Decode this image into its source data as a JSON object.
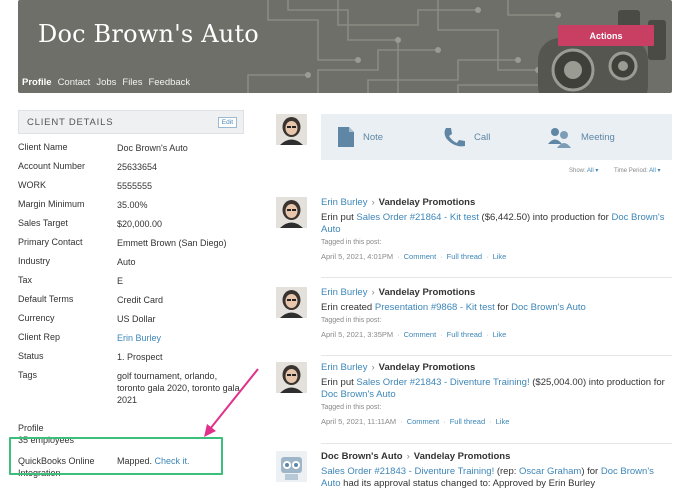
{
  "header": {
    "company_name": "Doc Brown's Auto",
    "actions_label": "Actions",
    "tabs": [
      "Profile",
      "Contact",
      "Jobs",
      "Files",
      "Feedback"
    ],
    "brand_color": "#c83f63"
  },
  "details": {
    "title": "CLIENT DETAILS",
    "edit_label": "Edit",
    "rows": [
      {
        "key": "Client Name",
        "value": "Doc Brown's Auto"
      },
      {
        "key": "Account Number",
        "value": "25633654"
      },
      {
        "key": "WORK",
        "value": "5555555"
      },
      {
        "key": "Margin Minimum",
        "value": "35.00%"
      },
      {
        "key": "Sales Target",
        "value": "$20,000.00"
      },
      {
        "key": "Primary Contact",
        "value": "Emmett Brown (San Diego)"
      },
      {
        "key": "Industry",
        "value": "Auto"
      },
      {
        "key": "Tax",
        "value": "E"
      },
      {
        "key": "Default Terms",
        "value": "Credit Card"
      },
      {
        "key": "Currency",
        "value": "US Dollar"
      },
      {
        "key": "Client Rep",
        "value": "Erin Burley"
      },
      {
        "key": "Status",
        "value": "1. Prospect"
      },
      {
        "key": "Tags",
        "value": "golf tournament, orlando, toronto gala 2020, toronto gala 2021"
      }
    ],
    "profile_label": "Profile",
    "profile_value": "35 employees",
    "qb_label": "QuickBooks Online Integration",
    "qb_value": "Mapped.",
    "qb_link": "Check it.",
    "highlight_color": "#3bbf7a",
    "arrow_color": "#e0318a"
  },
  "quick_actions": {
    "note": "Note",
    "call": "Call",
    "meeting": "Meeting"
  },
  "filters": {
    "show_label": "Show:",
    "show_value": "All ▾",
    "period_label": "Time Period:",
    "period_value": "All ▾"
  },
  "feed": [
    {
      "author": "Erin Burley",
      "target": "Vandelay Promotions",
      "text_pre": "Erin put ",
      "link1": "Sales Order #21864 - Kit test",
      "text_mid": " ($6,442.50) into production for ",
      "link2": "Doc Brown's Auto",
      "tagged": "Tagged in this post:",
      "date": "April 5, 2021, 4:01PM",
      "comment": "Comment",
      "thread": "Full thread",
      "like": "Like"
    },
    {
      "author": "Erin Burley",
      "target": "Vandelay Promotions",
      "text_pre": "Erin created ",
      "link1": "Presentation #9868 - Kit test",
      "text_mid": " for ",
      "link2": "Doc Brown's Auto",
      "tagged": "Tagged in this post:",
      "date": "April 5, 2021, 3:35PM",
      "comment": "Comment",
      "thread": "Full thread",
      "like": "Like"
    },
    {
      "author": "Erin Burley",
      "target": "Vandelay Promotions",
      "text_pre": "Erin put ",
      "link1": "Sales Order #21843 - Diventure Training!",
      "text_mid": " ($25,004.00) into production for ",
      "link2": "Doc Brown's Auto",
      "tagged": "Tagged in this post:",
      "date": "April 5, 2021, 11:11AM",
      "comment": "Comment",
      "thread": "Full thread",
      "like": "Like"
    },
    {
      "author": "Doc Brown's Auto",
      "target": "Vandelay Promotions",
      "link1": "Sales Order #21843 - Diventure Training!",
      "text_a": " (rep: ",
      "rep": "Oscar Graham",
      "text_b": ") for ",
      "link2": "Doc Brown's Auto",
      "text_c": " had its approval status changed to: Approved by Erin Burley"
    }
  ]
}
